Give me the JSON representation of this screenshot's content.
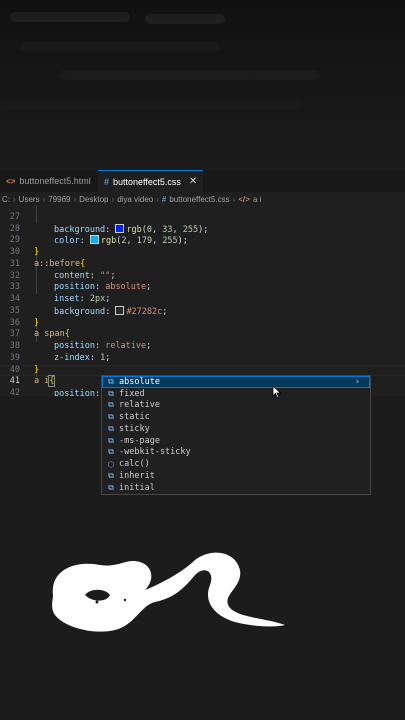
{
  "tabs": [
    {
      "label": "buttoneffect5.html",
      "icon": "html-file-icon",
      "active": false
    },
    {
      "label": "buttoneffect5.css",
      "icon": "css-file-icon",
      "active": true
    }
  ],
  "breadcrumb": [
    "C:",
    "Users",
    "79969",
    "Desktop",
    "diya video",
    "buttoneffect5.css",
    "a i"
  ],
  "editor": {
    "lines": [
      {
        "num": "27",
        "text": "background: rgb(0, 33, 255);"
      },
      {
        "num": "28",
        "text": "color: rgb(2, 179, 255);"
      },
      {
        "num": "29",
        "text": "}"
      },
      {
        "num": "30",
        "text": "a::before{"
      },
      {
        "num": "31",
        "text": "content: \"\";"
      },
      {
        "num": "32",
        "text": "position: absolute;"
      },
      {
        "num": "33",
        "text": "inset: 2px;"
      },
      {
        "num": "34",
        "text": "background: #27282c;"
      },
      {
        "num": "35",
        "text": "}"
      },
      {
        "num": "36",
        "text": "a span{"
      },
      {
        "num": "37",
        "text": "position: relative;"
      },
      {
        "num": "38",
        "text": "z-index: 1;"
      },
      {
        "num": "39",
        "text": "}"
      },
      {
        "num": "40",
        "text": "a i{"
      },
      {
        "num": "41",
        "text": "position: ;"
      },
      {
        "num": "42",
        "text": "}"
      }
    ],
    "current_line": "41"
  },
  "suggestions": [
    {
      "label": "absolute",
      "icon": "property-value-icon",
      "active": true
    },
    {
      "label": "fixed",
      "icon": "property-value-icon"
    },
    {
      "label": "relative",
      "icon": "property-value-icon"
    },
    {
      "label": "static",
      "icon": "property-value-icon"
    },
    {
      "label": "sticky",
      "icon": "property-value-icon"
    },
    {
      "label": "-ms-page",
      "icon": "property-value-icon"
    },
    {
      "label": "-webkit-sticky",
      "icon": "property-value-icon"
    },
    {
      "label": "calc()",
      "icon": "function-cube-icon"
    },
    {
      "label": "inherit",
      "icon": "property-value-icon"
    },
    {
      "label": "initial",
      "icon": "property-value-icon"
    }
  ],
  "colors": {
    "swatch_blue": "#02b3ff",
    "swatch_bg": "#27282c",
    "accent": "#0078d4",
    "selection": "#04395e"
  }
}
